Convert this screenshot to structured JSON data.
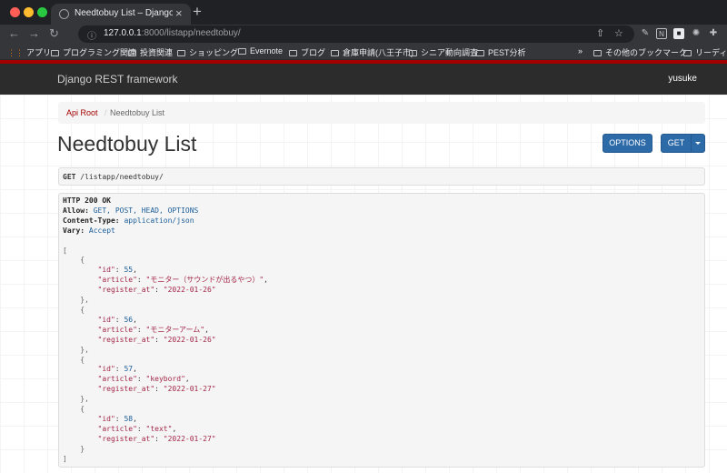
{
  "browser": {
    "tab_title": "Needtobuy List – Django REST framework",
    "tab_close": "×",
    "new_tab": "+",
    "url_host": "127.0.0.1",
    "url_rest": ":8000/listapp/needtobuy/",
    "icons": [
      "back-icon",
      "forward-icon",
      "reload-icon",
      "lock-icon",
      "share-icon",
      "star-icon",
      "puzzle-icon"
    ]
  },
  "bookmarks": {
    "apps": "アプリ",
    "items": [
      "プログラミング関連",
      "投資関連",
      "ショッピング",
      "Evernote",
      "ブログ",
      "倉庫申請(八王子市)",
      "シニア動向調査",
      "PEST分析"
    ],
    "overflow": "»",
    "other": "その他のブックマーク",
    "reading": "リーディ"
  },
  "navbar": {
    "brand": "Django REST framework",
    "user": "yusuke"
  },
  "breadcrumb": {
    "root": "Api Root",
    "separator": "/",
    "current": "Needtobuy List"
  },
  "page": {
    "title": "Needtobuy List",
    "options_label": "OPTIONS",
    "get_label": "GET"
  },
  "request": {
    "method": "GET",
    "path": "/listapp/needtobuy/"
  },
  "response": {
    "status": "HTTP 200 OK",
    "allow_label": "Allow:",
    "allow_value": "GET, POST, HEAD, OPTIONS",
    "content_type_label": "Content-Type:",
    "content_type_value": "application/json",
    "vary_label": "Vary:",
    "vary_value": "Accept",
    "items": [
      {
        "id": 55,
        "article": "モニター（サウンドが出るやつ）",
        "register_at": "2022-01-26"
      },
      {
        "id": 56,
        "article": "モニターアーム",
        "register_at": "2022-01-26"
      },
      {
        "id": 57,
        "article": "keybord",
        "register_at": "2022-01-27"
      },
      {
        "id": 58,
        "article": "text",
        "register_at": "2022-01-27"
      }
    ]
  },
  "colors": {
    "accent_red": "#a30000",
    "button_blue": "#2c6aa8",
    "navbar_bg": "#2c2c2c"
  }
}
